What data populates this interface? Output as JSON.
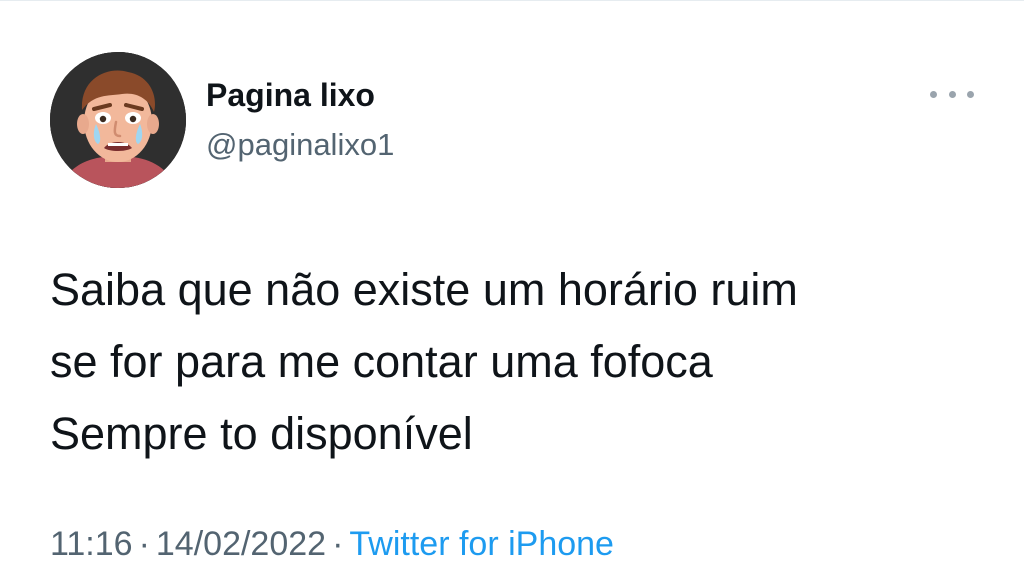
{
  "tweet": {
    "author": {
      "display_name": "Pagina lixo",
      "handle": "@paginalixo1",
      "avatar_icon": "cartoon-crying-man-avatar"
    },
    "more_icon": "ellipsis-icon",
    "text_lines": [
      "Saiba que não existe um horário ruim",
      "se for para me contar uma fofoca",
      "Sempre to disponível"
    ],
    "time": "11:16",
    "separator": "·",
    "date": "14/02/2022",
    "source": "Twitter for iPhone"
  },
  "colors": {
    "text": "#0f1419",
    "secondary": "#536471",
    "link": "#1d9bf0"
  }
}
